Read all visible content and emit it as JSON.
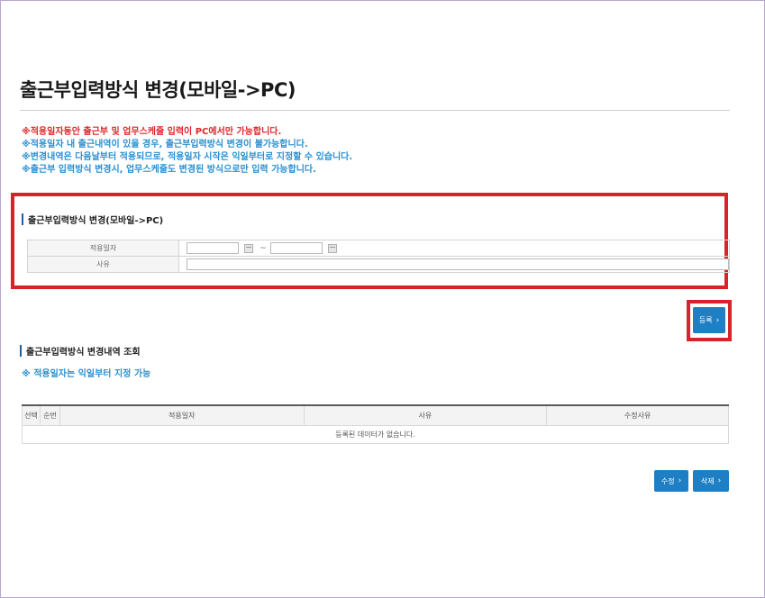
{
  "page": {
    "title": "출근부입력방식 변경(모바일->PC)"
  },
  "notices": [
    {
      "text": "※적용일자동안 출근부 및 업무스케줄 입력이 PC에서만 가능합니다.",
      "color": "#e0262a"
    },
    {
      "text": "※적용일자 내 출근내역이 있을 경우, 출근부입력방식 변경이 불가능합니다.",
      "color": "#2a8fd0"
    },
    {
      "text": "※변경내역은 다음날부터 적용되므로, 적용일자 시작은 익일부터로 지정할 수 있습니다.",
      "color": "#2a8fd0"
    },
    {
      "text": "※출근부 입력방식 변경시, 업무스케줄도 변경된 방식으로만 입력 가능합니다.",
      "color": "#2a8fd0"
    }
  ],
  "form_section": {
    "heading": "출근부입력방식 변경(모바일->PC)",
    "date_label": "적용일자",
    "date_separator": "~",
    "reason_label": "사유",
    "start_date_value": "",
    "end_date_value": "",
    "reason_value": ""
  },
  "register_button": {
    "label": "등록",
    "icon": "chevron-right-icon"
  },
  "history_section": {
    "heading": "출근부입력방식 변경내역 조회",
    "note": "※ 적용일자는 익일부터 지정 가능",
    "columns": [
      "선택",
      "순번",
      "적용일자",
      "사유",
      "수정사유"
    ],
    "empty_message": "등록된 데이터가 없습니다."
  },
  "actions": {
    "edit_label": "수정",
    "delete_label": "삭제"
  },
  "colors": {
    "accent_blue": "#1f7fc4",
    "highlight_red": "#d8232a",
    "notice_red": "#e0262a",
    "notice_blue": "#2a8fd0"
  }
}
